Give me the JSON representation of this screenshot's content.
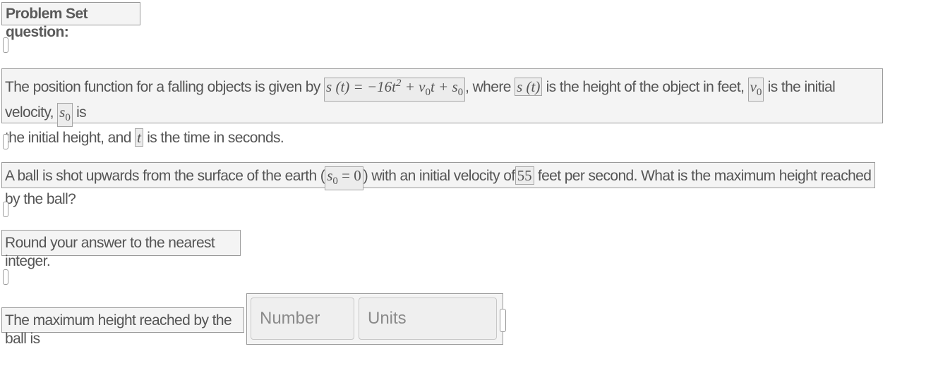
{
  "header": {
    "title": "Problem Set question:"
  },
  "paragraph1": {
    "intro": "The position function for a falling objects is given by",
    "formula_lhs": "s (t) = −16t",
    "formula_exp": "2",
    "formula_plus1": " + v",
    "formula_sub1": "0",
    "formula_t": "t + s",
    "formula_sub2": "0",
    "where": ", where",
    "s_of_t": "s (t)",
    "height_desc": "is the height of the object in feet,",
    "v_sym": "v",
    "v_sub": "0",
    "velocity_desc": "is the initial velocity,",
    "s_sym": "s",
    "s_sub": "0",
    "is_word": "is",
    "line2": "the initial height, and",
    "t_sym": "t",
    "time_desc": "is the time in seconds."
  },
  "paragraph2": {
    "text1": "A ball is shot upwards from the surface of the earth (",
    "s_sym": "s",
    "s_sub": "0",
    "eq": " = 0",
    "text2": ") with an initial velocity of",
    "velocity": "55",
    "text3": "feet per second. What is the maximum height reached by the ball?"
  },
  "paragraph3": {
    "text": "Round your answer to the nearest integer."
  },
  "answer": {
    "label": "The maximum height reached by the ball is",
    "number_placeholder": "Number",
    "units_placeholder": "Units"
  }
}
